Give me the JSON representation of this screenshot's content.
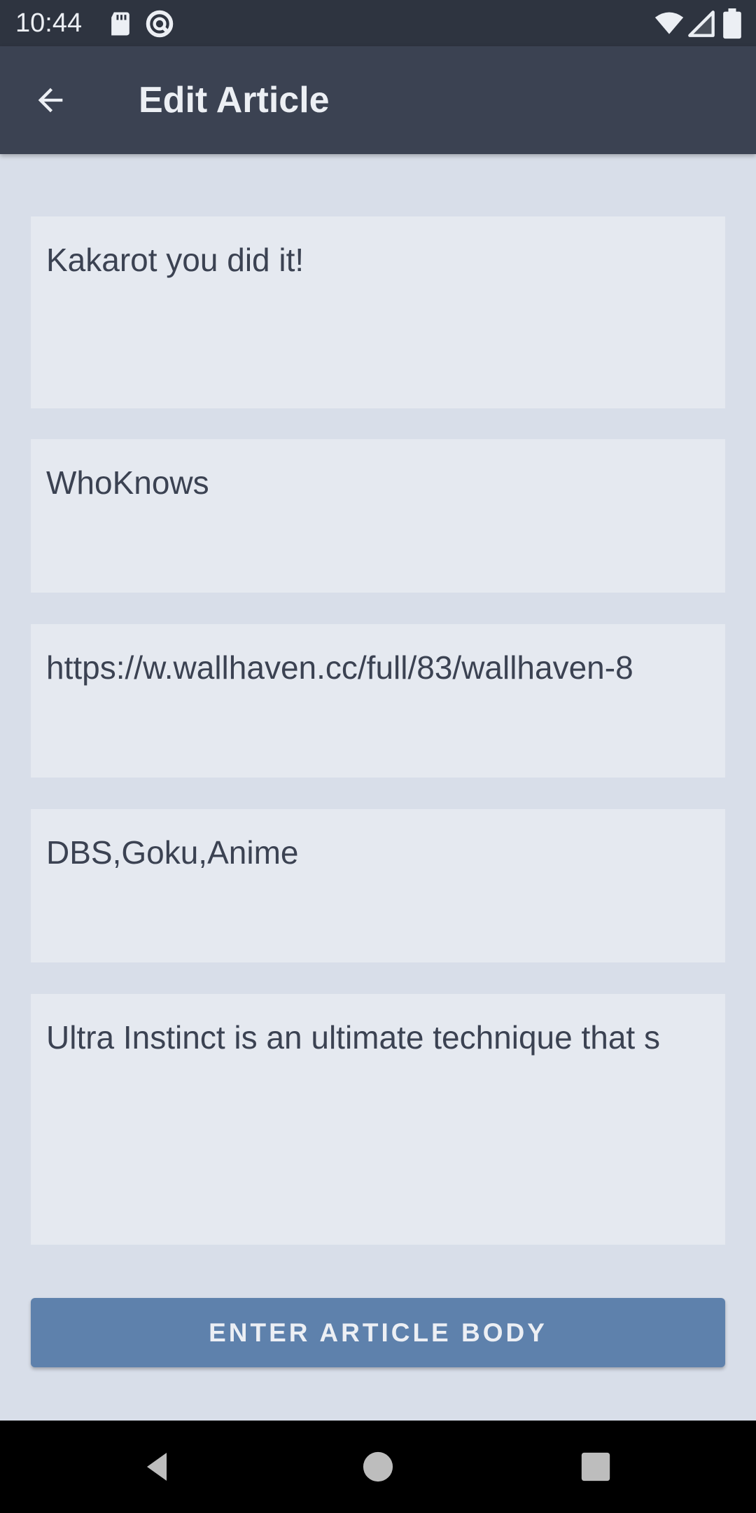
{
  "status_bar": {
    "time": "10:44",
    "left_icons": [
      "sd-card-icon",
      "do-not-disturb-icon"
    ],
    "right_icons": [
      "wifi-icon",
      "signal-icon",
      "battery-icon"
    ]
  },
  "app_bar": {
    "title": "Edit Article",
    "back_icon": "arrow-back-icon"
  },
  "form": {
    "title_value": "Kakarot you did it!",
    "author_value": "WhoKnows",
    "image_url_value": "https://w.wallhaven.cc/full/83/wallhaven-8",
    "tags_value": "DBS,Goku,Anime",
    "body_value": "Ultra Instinct is an ultimate technique that s",
    "submit_label": "ENTER ARTICLE BODY"
  },
  "colors": {
    "status_bar": "#2E3440",
    "app_bar": "#3B4252",
    "background": "#D8DEE9",
    "field": "#E5E9F0",
    "button": "#5E81AC",
    "nav_bar": "#000000"
  }
}
